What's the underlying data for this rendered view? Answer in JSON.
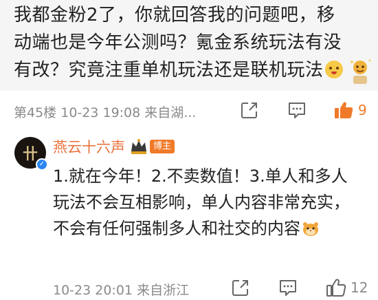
{
  "quoted_comment": {
    "text": "我都金粉2了，你就回答我的问题吧，移动端也是今年公测吗？氪金系统玩法有没有改？究竟注重单机玩法还是联机玩法",
    "emoji": "smiling-face-emoji",
    "floor": "第45楼",
    "time": "10-23 19:08",
    "location": "来自湖...",
    "like_count": "9",
    "liked": true
  },
  "reply": {
    "author": "燕云十六声",
    "author_badge": "博主",
    "avatar_text": "卄",
    "text": "1.就在今年！2.不卖数值！3.单人和多人玩法不会互相影响，单人内容非常充实，不会有任何强制多人和社交的内容",
    "emoji": "hamster-emoji",
    "time": "10-23 20:01",
    "location": "来自浙江",
    "like_count": "12",
    "liked": false
  },
  "colors": {
    "accent_orange": "#f07a2a",
    "author_name": "#e8733c",
    "meta_gray": "#8a8a8a",
    "verified_blue": "#2b86f2",
    "quote_bg": "#f5f5f5"
  }
}
